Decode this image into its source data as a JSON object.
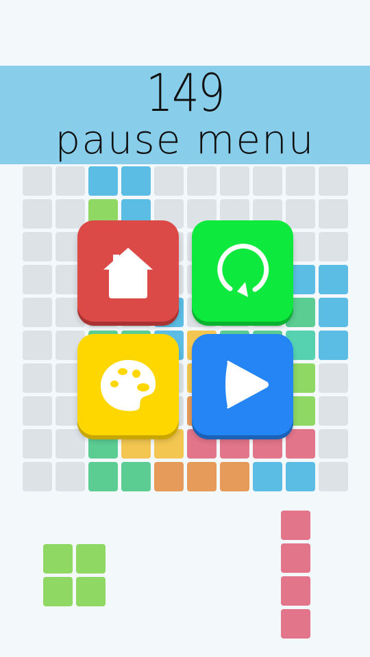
{
  "header": {
    "score": "149",
    "title": "pause menu"
  },
  "colors": {
    "background": "#f3f8fb",
    "banner": "#88cde9",
    "empty_cell": "#dde2e6",
    "blue": "#5bbde3",
    "green": "#8fd863",
    "teal": "#5bcd93",
    "mint": "#56d2b0",
    "yellow": "#f2c650",
    "orange": "#e79b5b",
    "pink": "#e2758a"
  },
  "grid": {
    "rows": 10,
    "cols": 10,
    "cells": [
      [
        "e",
        "e",
        "blue",
        "blue",
        "e",
        "e",
        "e",
        "e",
        "e",
        "e"
      ],
      [
        "e",
        "e",
        "green",
        "blue",
        "e",
        "e",
        "e",
        "e",
        "e",
        "e"
      ],
      [
        "e",
        "e",
        "e",
        "e",
        "e",
        "e",
        "e",
        "e",
        "e",
        "e"
      ],
      [
        "e",
        "e",
        "e",
        "e",
        "e",
        "e",
        "e",
        "e",
        "blue",
        "blue"
      ],
      [
        "e",
        "e",
        "e",
        "e",
        "blue",
        "e",
        "e",
        "e",
        "teal",
        "blue"
      ],
      [
        "e",
        "e",
        "teal",
        "teal",
        "blue",
        "yellow",
        "teal",
        "teal",
        "mint",
        "blue"
      ],
      [
        "e",
        "e",
        "e",
        "e",
        "e",
        "yellow",
        "e",
        "e",
        "green",
        "e"
      ],
      [
        "e",
        "e",
        "e",
        "e",
        "e",
        "orange",
        "e",
        "e",
        "green",
        "e"
      ],
      [
        "e",
        "e",
        "teal",
        "yellow",
        "yellow",
        "pink",
        "pink",
        "pink",
        "pink",
        "e"
      ],
      [
        "e",
        "e",
        "teal",
        "teal",
        "orange",
        "orange",
        "orange",
        "blue",
        "blue",
        "e"
      ]
    ]
  },
  "pieces": [
    {
      "name": "square",
      "color": "green",
      "shape": [
        [
          1,
          1
        ],
        [
          1,
          1
        ]
      ]
    },
    {
      "name": "bar",
      "color": "pink",
      "shape": [
        [
          1
        ],
        [
          1
        ],
        [
          1
        ],
        [
          1
        ]
      ]
    }
  ],
  "menu": {
    "buttons": [
      {
        "id": "home",
        "icon": "home-icon",
        "color": "#dc4a48",
        "shadow": "#a93331"
      },
      {
        "id": "restart",
        "icon": "restart-icon",
        "color": "#0ee93e",
        "shadow": "#0ab32f"
      },
      {
        "id": "theme",
        "icon": "palette-icon",
        "color": "#fed700",
        "shadow": "#c9a600"
      },
      {
        "id": "resume",
        "icon": "play-icon",
        "color": "#2585f4",
        "shadow": "#1b61b5"
      }
    ]
  }
}
